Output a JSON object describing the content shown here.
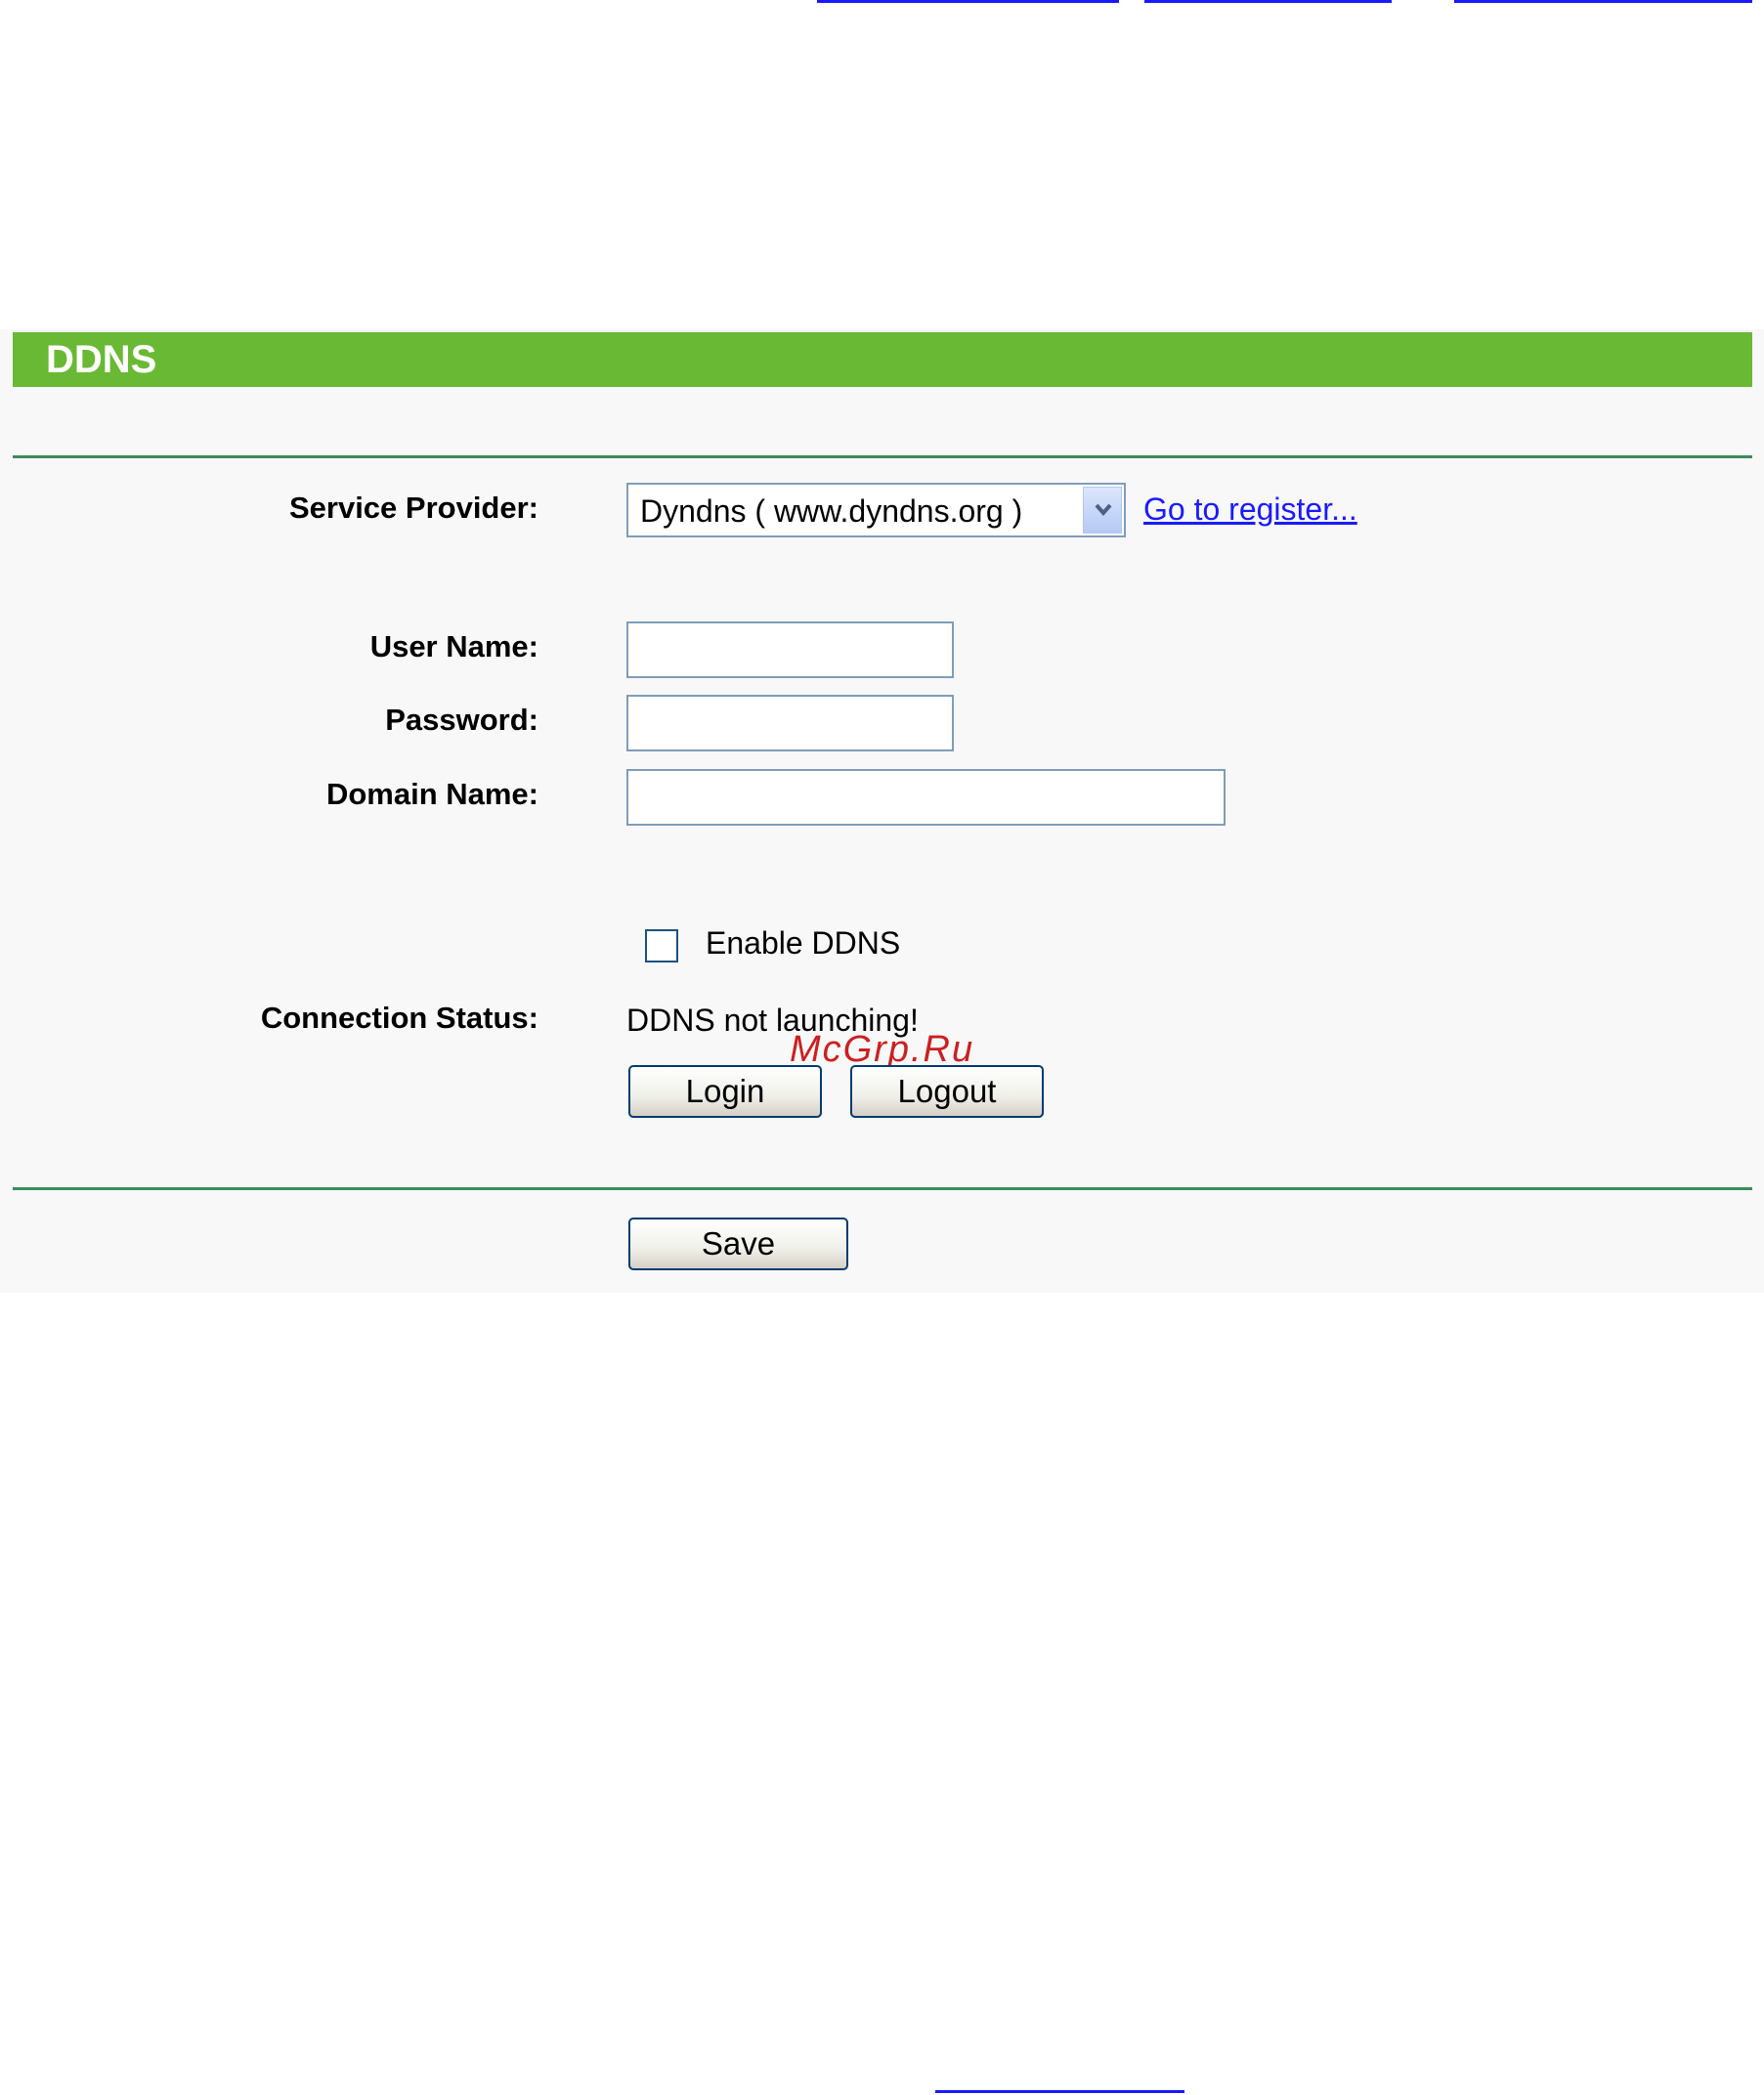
{
  "header": {
    "title": "DDNS"
  },
  "form": {
    "service_provider": {
      "label": "Service Provider:",
      "selected": "Dyndns ( www.dyndns.org )",
      "register_link": "Go to register..."
    },
    "user_name": {
      "label": "User Name:",
      "value": ""
    },
    "password": {
      "label": "Password:",
      "value": ""
    },
    "domain_name": {
      "label": "Domain Name:",
      "value": ""
    },
    "enable_ddns": {
      "label": "Enable DDNS",
      "checked": false
    },
    "connection_status": {
      "label": "Connection Status:",
      "value": "DDNS not launching!"
    },
    "login_label": "Login",
    "logout_label": "Logout",
    "save_label": "Save"
  },
  "watermark": "McGrp.Ru",
  "colors": {
    "title_bar": "#6ab934",
    "rule": "#3d8a5c",
    "link": "#1a1aff",
    "panel_bg": "#f8f8f8"
  },
  "icons": {
    "dropdown": "chevron-down-icon"
  }
}
